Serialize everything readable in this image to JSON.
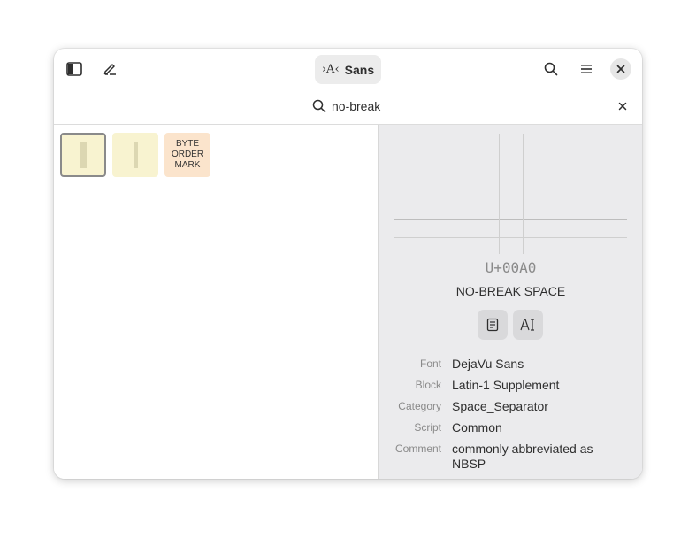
{
  "header": {
    "font_button": {
      "glyph": "›A‹",
      "label": "Sans"
    }
  },
  "search": {
    "value": "no-break"
  },
  "grid": {
    "cells": [
      {
        "type": "glyph",
        "selected": true
      },
      {
        "type": "glyph",
        "selected": false
      },
      {
        "type": "label",
        "text": "BYTE\nORDER\nMARK",
        "selected": false
      }
    ],
    "colors": {
      "glyph_bg": "#f8f3d0",
      "label_bg": "#fbe4cc",
      "selection_border": "#8a8a8a"
    }
  },
  "details": {
    "codepoint": "U+00A0",
    "name": "NO-BREAK SPACE",
    "properties": [
      {
        "key": "Font",
        "value": "DejaVu Sans"
      },
      {
        "key": "Block",
        "value": "Latin-1 Supplement"
      },
      {
        "key": "Category",
        "value": "Space_Separator"
      },
      {
        "key": "Script",
        "value": "Common"
      },
      {
        "key": "Comment",
        "value": "commonly abbreviated as NBSP"
      }
    ]
  },
  "icons": {
    "sidebar_toggle": "sidebar-toggle-icon",
    "edit": "edit-pen-icon",
    "search": "search-icon",
    "menu": "hamburger-menu-icon",
    "close": "close-icon",
    "copy": "copy-icon",
    "font_info": "text-cursor-icon"
  }
}
